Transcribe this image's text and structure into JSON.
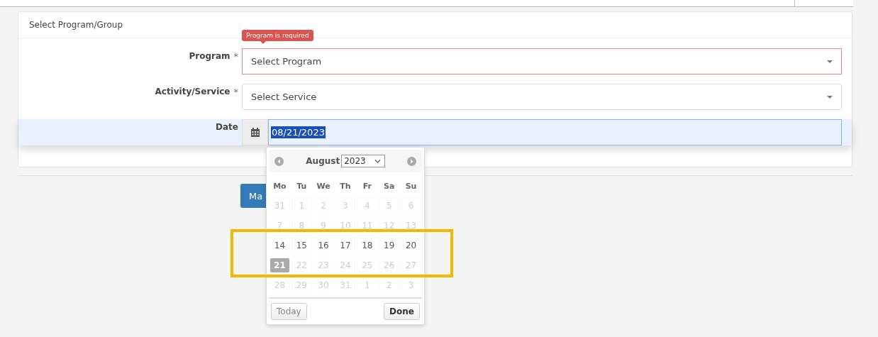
{
  "panel": {
    "title": "Select Program/Group"
  },
  "fields": [
    {
      "label": "Program",
      "required_mark": "*",
      "kind": "select",
      "placeholder": "Select Program",
      "error": "Program is required"
    },
    {
      "label": "Activity/Service",
      "required_mark": "*",
      "kind": "select",
      "placeholder": "Select Service"
    },
    {
      "label": "Date",
      "kind": "date",
      "value": "08/21/2023",
      "focused": true
    }
  ],
  "button": {
    "label": "Ma"
  },
  "datepicker": {
    "month": "August",
    "year": "2023",
    "weekdays": [
      "Mo",
      "Tu",
      "We",
      "Th",
      "Fr",
      "Sa",
      "Su"
    ],
    "weeks": [
      [
        {
          "d": "31",
          "disabled": true,
          "selected": false
        },
        {
          "d": "1",
          "disabled": true,
          "selected": false
        },
        {
          "d": "2",
          "disabled": true,
          "selected": false
        },
        {
          "d": "3",
          "disabled": true,
          "selected": false
        },
        {
          "d": "4",
          "disabled": true,
          "selected": false
        },
        {
          "d": "5",
          "disabled": true,
          "selected": false
        },
        {
          "d": "6",
          "disabled": true,
          "selected": false
        }
      ],
      [
        {
          "d": "7",
          "disabled": true,
          "selected": false
        },
        {
          "d": "8",
          "disabled": true,
          "selected": false
        },
        {
          "d": "9",
          "disabled": true,
          "selected": false
        },
        {
          "d": "10",
          "disabled": true,
          "selected": false
        },
        {
          "d": "11",
          "disabled": true,
          "selected": false
        },
        {
          "d": "12",
          "disabled": true,
          "selected": false
        },
        {
          "d": "13",
          "disabled": true,
          "selected": false
        }
      ],
      [
        {
          "d": "14",
          "disabled": false,
          "selected": false
        },
        {
          "d": "15",
          "disabled": false,
          "selected": false
        },
        {
          "d": "16",
          "disabled": false,
          "selected": false
        },
        {
          "d": "17",
          "disabled": false,
          "selected": false
        },
        {
          "d": "18",
          "disabled": false,
          "selected": false
        },
        {
          "d": "19",
          "disabled": false,
          "selected": false
        },
        {
          "d": "20",
          "disabled": false,
          "selected": false
        }
      ],
      [
        {
          "d": "21",
          "disabled": false,
          "selected": true
        },
        {
          "d": "22",
          "disabled": true,
          "selected": false
        },
        {
          "d": "23",
          "disabled": true,
          "selected": false
        },
        {
          "d": "24",
          "disabled": true,
          "selected": false
        },
        {
          "d": "25",
          "disabled": true,
          "selected": false
        },
        {
          "d": "26",
          "disabled": true,
          "selected": false
        },
        {
          "d": "27",
          "disabled": true,
          "selected": false
        }
      ],
      [
        {
          "d": "28",
          "disabled": true,
          "selected": false
        },
        {
          "d": "29",
          "disabled": true,
          "selected": false
        },
        {
          "d": "30",
          "disabled": true,
          "selected": false
        },
        {
          "d": "31",
          "disabled": true,
          "selected": false
        },
        {
          "d": "1",
          "disabled": true,
          "selected": false
        },
        {
          "d": "2",
          "disabled": true,
          "selected": false
        },
        {
          "d": "3",
          "disabled": true,
          "selected": false
        }
      ]
    ],
    "today_label": "Today",
    "done_label": "Done"
  },
  "annotation": {
    "color": "#f5b800"
  }
}
